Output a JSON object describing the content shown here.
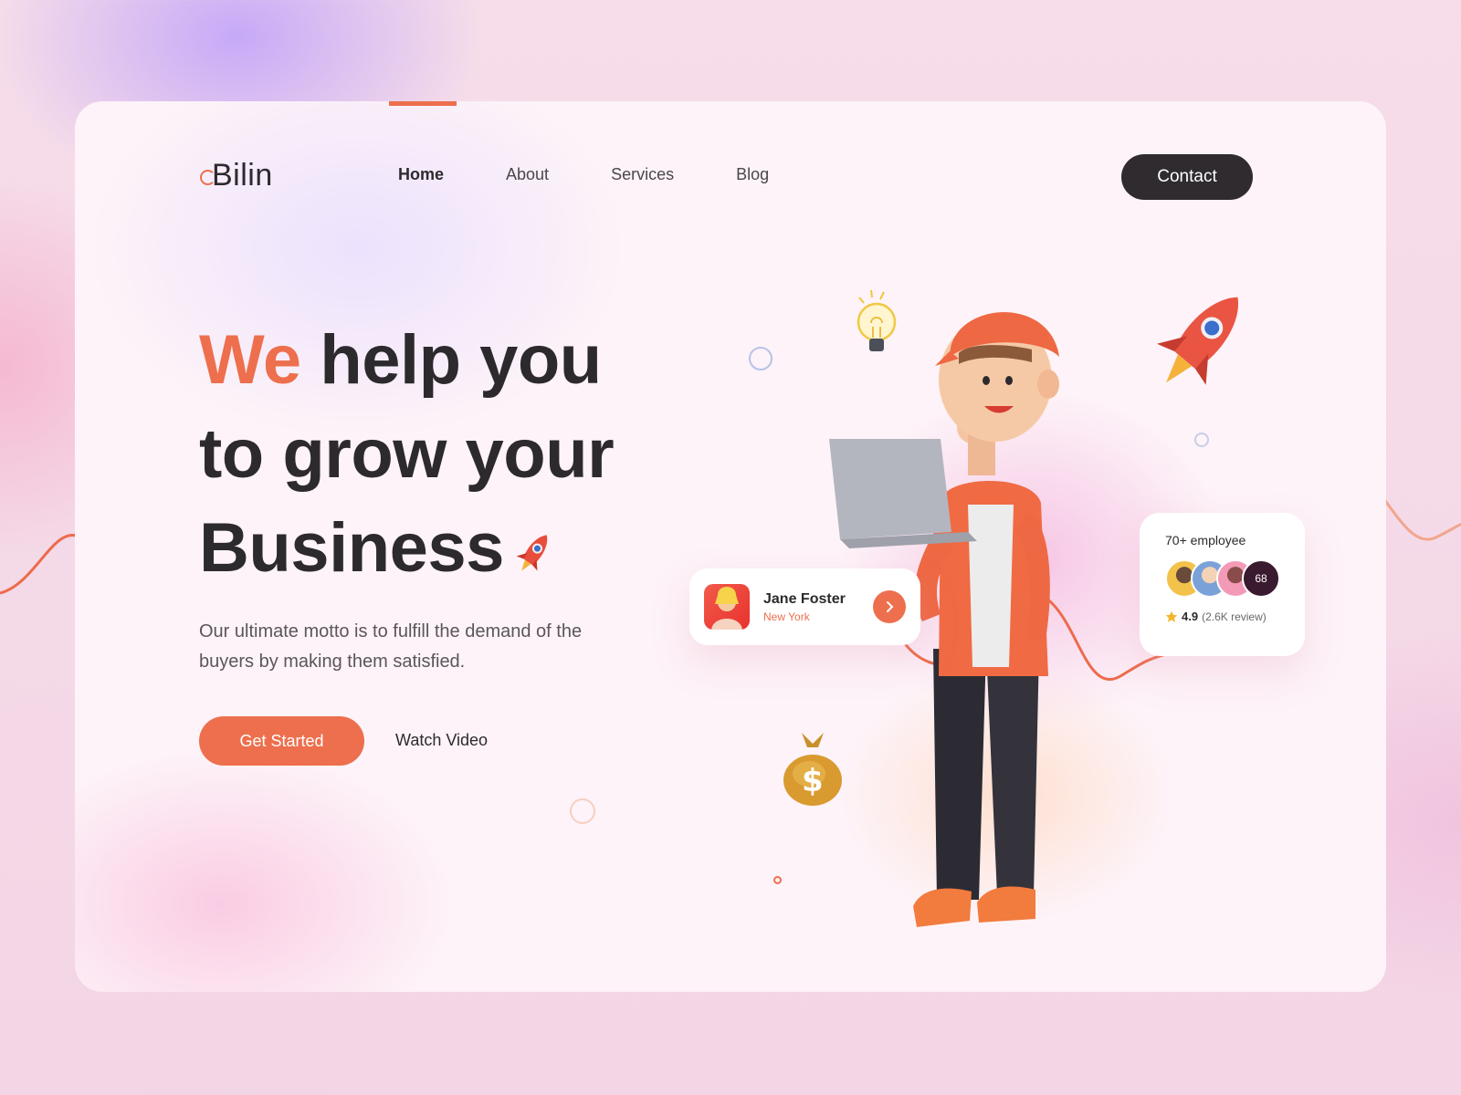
{
  "brand": {
    "logo_text": "Bilin"
  },
  "nav": {
    "items": [
      {
        "label": "Home",
        "active": true
      },
      {
        "label": "About",
        "active": false
      },
      {
        "label": "Services",
        "active": false
      },
      {
        "label": "Blog",
        "active": false
      }
    ],
    "contact_label": "Contact"
  },
  "hero": {
    "headline_accent": "We",
    "headline_line1_rest": "help you",
    "headline_line2": "to grow your",
    "headline_line3": "Business",
    "subtext": "Our ultimate motto is to fulfill the demand of the buyers by making them satisfied.",
    "primary_cta": "Get Started",
    "secondary_cta": "Watch Video"
  },
  "profile_card": {
    "name": "Jane Foster",
    "location": "New York"
  },
  "employee_card": {
    "title": "70+ employee",
    "extra_count": "68",
    "rating": "4.9",
    "reviews": "(2.6K review)"
  },
  "colors": {
    "accent": "#ed6f4d",
    "dark": "#2d2a2e",
    "background": "#fdf3f8"
  },
  "icons": [
    "rocket-icon",
    "lightbulb-icon",
    "money-bag-icon",
    "chevron-right-icon",
    "star-icon"
  ]
}
